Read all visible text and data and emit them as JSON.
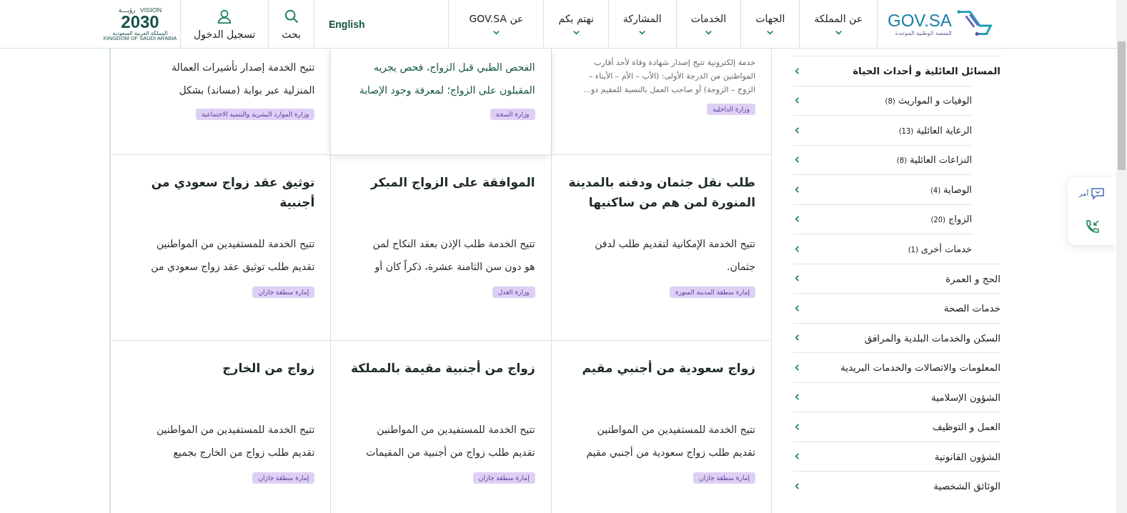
{
  "header": {
    "logo": {
      "name": "GOV.SA",
      "tagline": "المنصة الوطنية الموحدة"
    },
    "nav": [
      {
        "label": "عن المملكة"
      },
      {
        "label": "الجهات"
      },
      {
        "label": "الخدمات"
      },
      {
        "label": "المشاركة"
      },
      {
        "label": "نهتم بكم"
      },
      {
        "label": "عن GOV.SA"
      }
    ],
    "language": "English",
    "search": "بحث",
    "login": "تسجيل الدخول",
    "vision": {
      "word": "VISION",
      "arabic": "رؤيـــة",
      "year": "2030",
      "country_ar": "المملكة العربية السعودية",
      "country_en": "KINGDOM OF SAUDI ARABIA"
    }
  },
  "sidebar": {
    "items": [
      {
        "label": "المسائل العائلية و أحداث الحياة",
        "expanded": true,
        "children": [
          {
            "label": "الوفيات و المواريث",
            "count": "(8)"
          },
          {
            "label": "الرعاية العائلية",
            "count": "(13)"
          },
          {
            "label": "النزاعات العائلية",
            "count": "(8)"
          },
          {
            "label": "الوصاية",
            "count": "(4)"
          },
          {
            "label": "الزواج",
            "count": "(20)"
          },
          {
            "label": "خدمات أخرى",
            "count": "(1)"
          }
        ]
      },
      {
        "label": "الحج و العمرة",
        "expanded": false
      },
      {
        "label": "خدمات الصحة",
        "expanded": false
      },
      {
        "label": "السكن والخدمات البلدية والمرافق",
        "expanded": false
      },
      {
        "label": "المعلومات والاتصالات والخدمات البريدية",
        "expanded": false
      },
      {
        "label": "الشؤون الإسلامية",
        "expanded": false
      },
      {
        "label": "العمل و التوظيف",
        "expanded": false
      },
      {
        "label": "الشؤون القانونية",
        "expanded": false
      },
      {
        "label": "الوثائق الشخصية",
        "expanded": false
      }
    ]
  },
  "cards": [
    {
      "kind": "summary",
      "highlighted": false,
      "description": [
        "خدمة إلكترونية تتيح إصدار شهادة وفاة لأحد أقارب",
        "المواطنين من الدرجة الأولى: (الأب – الأم – الأبناء –",
        "الزوج – الزوجة) أو صاحب العمل بالنسبة للمقيم دو..."
      ],
      "tag": "وزارة الداخلية"
    },
    {
      "kind": "service",
      "highlighted": true,
      "description": [
        "الفحص الطبي قبل الزواج، فحص يجريه",
        "المقبلون على الزواج؛ لمعرفة وجود الإصابة"
      ],
      "tag": "وزارة الصحة"
    },
    {
      "kind": "service",
      "highlighted": false,
      "description": [
        "تتيح الخدمة إصدار تأشيرات العمالة",
        "المنزلية عبر بوابة (مساند) بشكل"
      ],
      "tag": "وزارة الموارد البشرية والتنمية الاجتماعية"
    },
    {
      "kind": "service",
      "highlighted": false,
      "title": "طلب نقل جثمان ودفنه بالمدينة المنورة لمن هم من ساكنيها",
      "description": [
        "تتيح الخدمة الإمكانية لتقديم طلب لدفن",
        "جثمان."
      ],
      "tag": "إمارة منطقة المدينة المنورة"
    },
    {
      "kind": "service",
      "highlighted": false,
      "title": "الموافقة على الزواج المبكر",
      "description": [
        "تتيح الخدمة طلب الإذن بعقد النكاح لمن",
        "هو دون سن الثامنة عشرة، ذكراً كان أو"
      ],
      "tag": "وزارة العدل"
    },
    {
      "kind": "service",
      "highlighted": false,
      "title": "توثيق عقد زواج سعودي من أجنبية",
      "description": [
        "تتيح الخدمة للمستفيدين من المواطنين",
        "تقديم طلب توثيق عقد زواج سعودي من"
      ],
      "tag": "إمارة منطقة جازان"
    },
    {
      "kind": "service",
      "highlighted": false,
      "title": "زواج سعودية من أجنبي مقيم",
      "description": [
        "تتيح الخدمة للمستفيدين من المواطنين",
        "تقديم طلب زواج سعودية من أجنبي مقيم"
      ],
      "tag": "إمارة منطقة جازان"
    },
    {
      "kind": "service",
      "highlighted": false,
      "title": "زواج من أجنبية مقيمة بالمملكة",
      "description": [
        "تتيح الخدمة للمستفيدين من المواطنين",
        "تقديم طلب زواج من أجنبية من المقيمات"
      ],
      "tag": "إمارة منطقة جازان"
    },
    {
      "kind": "service",
      "highlighted": false,
      "title": "زواج من الخارج",
      "description": [
        "تتيح الخدمة للمستفيدين من المواطنين",
        "تقديم طلب زواج من الخارج بجميع"
      ],
      "tag": "إمارة منطقة جازان"
    }
  ],
  "floating": {
    "assistant": "آمر"
  }
}
